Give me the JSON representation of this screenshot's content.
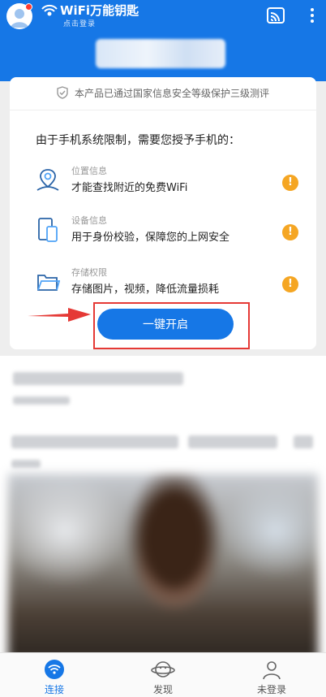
{
  "header": {
    "app_title": "WiFi万能钥匙",
    "login_sub": "点击登录",
    "icons": [
      "avatar-icon",
      "wifi-logo-icon",
      "screen-cast-icon",
      "more-vertical-icon"
    ],
    "colors": {
      "primary": "#1677e6",
      "badge": "#ff3b30"
    }
  },
  "card": {
    "certification": "本产品已通过国家信息安全等级保护三级测评",
    "intro": "由于手机系统限制，需要您授予手机的：",
    "permissions": [
      {
        "icon": "location-icon",
        "title": "位置信息",
        "desc": "才能查找附近的免费WiFi",
        "warn": "!"
      },
      {
        "icon": "device-icon",
        "title": "设备信息",
        "desc": "用于身份校验，保障您的上网安全",
        "warn": "!"
      },
      {
        "icon": "folder-icon",
        "title": "存储权限",
        "desc": "存储图片，视频，降低流量损耗",
        "warn": "!"
      }
    ],
    "enable_button": "一键开启",
    "warn_color": "#f5a623",
    "highlight_color": "#e53935"
  },
  "bottom_nav": {
    "items": [
      {
        "label": "连接",
        "icon": "wifi-icon",
        "active": true
      },
      {
        "label": "发现",
        "icon": "planet-icon",
        "active": false
      },
      {
        "label": "未登录",
        "icon": "user-icon",
        "active": false
      }
    ]
  }
}
